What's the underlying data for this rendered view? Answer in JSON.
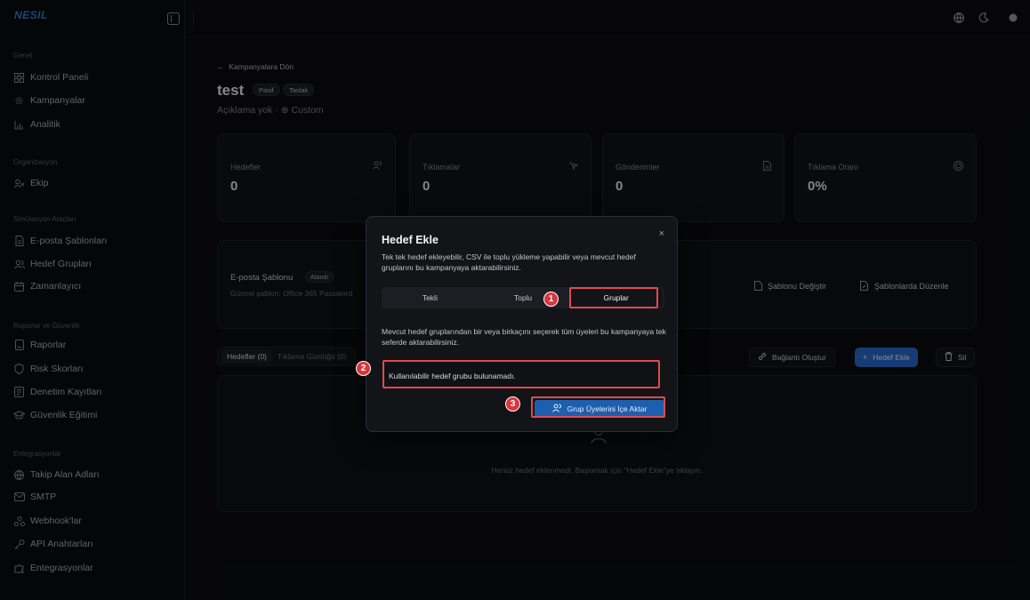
{
  "app": {
    "brand": "NESIL"
  },
  "sidebar": {
    "sections": [
      {
        "title": "Genel",
        "items": [
          {
            "label": "Kontrol Paneli",
            "icon": "grid-icon"
          },
          {
            "label": "Kampanyalar",
            "icon": "target-icon"
          },
          {
            "label": "Analitik",
            "icon": "chart-icon"
          }
        ]
      },
      {
        "title": "Organizasyon",
        "items": [
          {
            "label": "Ekip",
            "icon": "team-icon"
          }
        ]
      },
      {
        "title": "Simülasyon Araçları",
        "items": [
          {
            "label": "E-posta Şablonları",
            "icon": "document-icon"
          },
          {
            "label": "Hedef Grupları",
            "icon": "users-icon"
          },
          {
            "label": "Zamanlayıcı",
            "icon": "calendar-icon"
          }
        ]
      },
      {
        "title": "Raporlar ve Güvenlik",
        "items": [
          {
            "label": "Raporlar",
            "icon": "report-icon"
          },
          {
            "label": "Risk Skorları",
            "icon": "shield-icon"
          },
          {
            "label": "Denetim Kayıtları",
            "icon": "log-icon"
          },
          {
            "label": "Güvenlik Eğitimi",
            "icon": "graduation-icon"
          }
        ]
      },
      {
        "title": "Entegrasyonlar",
        "items": [
          {
            "label": "Takip Alan Adları",
            "icon": "globe-icon"
          },
          {
            "label": "SMTP",
            "icon": "mail-icon"
          },
          {
            "label": "Webhook'lar",
            "icon": "webhook-icon"
          },
          {
            "label": "API Anahtarları",
            "icon": "key-icon"
          },
          {
            "label": "Entegrasyonlar",
            "icon": "puzzle-icon"
          }
        ]
      }
    ]
  },
  "topbar": {
    "icons": [
      "globe-icon",
      "moon-icon",
      "avatar"
    ]
  },
  "campaign": {
    "back_label": "Kampanyalara Dön",
    "title": "test",
    "badges": [
      "Pasif",
      "Taslak"
    ],
    "subtitle": "Açıklama yok · ⊕ Custom"
  },
  "stats": [
    {
      "label": "Hedefler",
      "value": "0",
      "icon": "users-icon"
    },
    {
      "label": "Tıklamalar",
      "value": "0",
      "icon": "click-icon"
    },
    {
      "label": "Gönderimler",
      "value": "0",
      "icon": "document-icon"
    },
    {
      "label": "Tıklama Oranı",
      "value": "0%",
      "icon": "target-icon"
    }
  ],
  "template": {
    "label": "E-posta Şablonu",
    "badge": "Atandı",
    "current": "Güncel şablon: Office 365 Password",
    "change_label": "Şablonu Değiştir",
    "edit_label": "Şablonlarda Düzenle"
  },
  "targets": {
    "tabs": [
      "Hedefler (0)",
      "Tıklama Günlüğü (0)"
    ],
    "link_label": "Bağlantı Oluştur",
    "add_label": "Hedef Ekle",
    "delete_label": "Sil",
    "empty_text": "Henüz hedef eklenmedi. Başlamak için \"Hedef Ekle\"ye tıklayın."
  },
  "modal": {
    "title": "Hedef Ekle",
    "close": "×",
    "description": "Tek tek hedef ekleyebilir, CSV ile toplu yükleme yapabilir veya mevcut hedef gruplarını bu kampanyaya aktarabilirsiniz.",
    "tabs": [
      "Tekli",
      "Toplu",
      "Gruplar"
    ],
    "active_tab": "Gruplar",
    "info": "Mevcut hedef gruplarından bir veya birkaçını seçerek tüm üyeleri bu kampanyaya tek seferde aktarabilirsiniz.",
    "empty": "Kullanılabilir hedef grubu bulunamadı.",
    "import_label": "Grup Üyelerini İçe Aktar"
  },
  "annotations": {
    "markers": [
      "1",
      "2",
      "3"
    ],
    "color": "#e04a4f"
  }
}
